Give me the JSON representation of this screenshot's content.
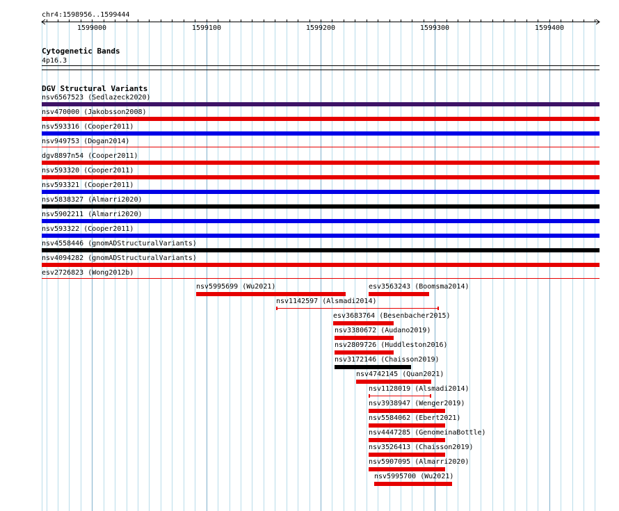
{
  "ruler": {
    "location": "chr4:1598956..1599444",
    "start": 1598956,
    "end": 1599444,
    "ticks": [
      {
        "pos": 1599000,
        "label": "1599000"
      },
      {
        "pos": 1599100,
        "label": "1599100"
      },
      {
        "pos": 1599200,
        "label": "1599200"
      },
      {
        "pos": 1599300,
        "label": "1599300"
      },
      {
        "pos": 1599400,
        "label": "1599400"
      }
    ]
  },
  "cytobands": {
    "title": "Cytogenetic Bands",
    "band": "4p16.3"
  },
  "dgv": {
    "title": "DGV Structural Variants",
    "colors": {
      "loss": "#e60000",
      "gain": "#0000e6",
      "complex": "#3d1366",
      "other": "#000000"
    },
    "full_rows": [
      {
        "label": "nsv6567523 (Sedlazeck2020)",
        "color": "#3d1366"
      },
      {
        "label": "nsv470000 (Jakobsson2008)",
        "color": "#e60000"
      },
      {
        "label": "nsv593316 (Cooper2011)",
        "color": "#0000e6"
      },
      {
        "label": "nsv949753 (Dogan2014)",
        "color": "#e60000",
        "style": "thin"
      },
      {
        "label": "dgv8897n54 (Cooper2011)",
        "color": "#e60000"
      },
      {
        "label": "nsv593320 (Cooper2011)",
        "color": "#e60000"
      },
      {
        "label": "nsv593321 (Cooper2011)",
        "color": "#0000e6"
      },
      {
        "label": "nsv5838327 (Almarri2020)",
        "color": "#000000"
      },
      {
        "label": "nsv5902211 (Almarri2020)",
        "color": "#0000e6"
      },
      {
        "label": "nsv593322 (Cooper2011)",
        "color": "#0000e6"
      },
      {
        "label": "nsv4558446 (gnomADStructuralVariants)",
        "color": "#000000"
      },
      {
        "label": "nsv4094282 (gnomADStructuralVariants)",
        "color": "#e60000"
      },
      {
        "label": "esv2726823 (Wong2012b)",
        "color": "#e60000",
        "style": "thin"
      }
    ],
    "partial_rows": [
      {
        "label": "nsv5995699 (Wu2021)",
        "start": 1599091,
        "end": 1599222,
        "color": "#e60000",
        "row": 0
      },
      {
        "label": "esv3563243 (Boomsma2014)",
        "start": 1599242,
        "end": 1599295,
        "color": "#e60000",
        "row": 0
      },
      {
        "label": "nsv1142597 (Alsmadi2014)",
        "start": 1599161,
        "end": 1599303,
        "color": "#e60000",
        "row": 1,
        "style": "thin"
      },
      {
        "label": "esv3683764 (Besenbacher2015)",
        "start": 1599211,
        "end": 1599264,
        "color": "#e60000",
        "row": 2
      },
      {
        "label": "nsv3380672 (Audano2019)",
        "start": 1599212,
        "end": 1599264,
        "color": "#e60000",
        "row": 3
      },
      {
        "label": "nsv2809726 (Huddleston2016)",
        "start": 1599212,
        "end": 1599264,
        "color": "#e60000",
        "row": 4
      },
      {
        "label": "nsv3172146 (Chaisson2019)",
        "start": 1599212,
        "end": 1599279,
        "color": "#000000",
        "row": 5
      },
      {
        "label": "nsv4742145 (Quan2021)",
        "start": 1599231,
        "end": 1599297,
        "color": "#e60000",
        "row": 6
      },
      {
        "label": "nsv1128019 (Alsmadi2014)",
        "start": 1599242,
        "end": 1599296,
        "color": "#e60000",
        "row": 7,
        "style": "thin"
      },
      {
        "label": "nsv3938947 (Wenger2019)",
        "start": 1599242,
        "end": 1599309,
        "color": "#e60000",
        "row": 8
      },
      {
        "label": "nsv5584062 (Ebert2021)",
        "start": 1599242,
        "end": 1599309,
        "color": "#e60000",
        "row": 9
      },
      {
        "label": "nsv4447285 (GenomeinaBottle)",
        "start": 1599242,
        "end": 1599309,
        "color": "#e60000",
        "row": 10
      },
      {
        "label": "nsv3526413 (Chaisson2019)",
        "start": 1599242,
        "end": 1599309,
        "color": "#e60000",
        "row": 11
      },
      {
        "label": "nsv5907095 (Almarri2020)",
        "start": 1599242,
        "end": 1599309,
        "color": "#e60000",
        "row": 12
      },
      {
        "label": "nsv5995700 (Wu2021)",
        "start": 1599247,
        "end": 1599315,
        "color": "#e60000",
        "row": 13
      }
    ]
  }
}
